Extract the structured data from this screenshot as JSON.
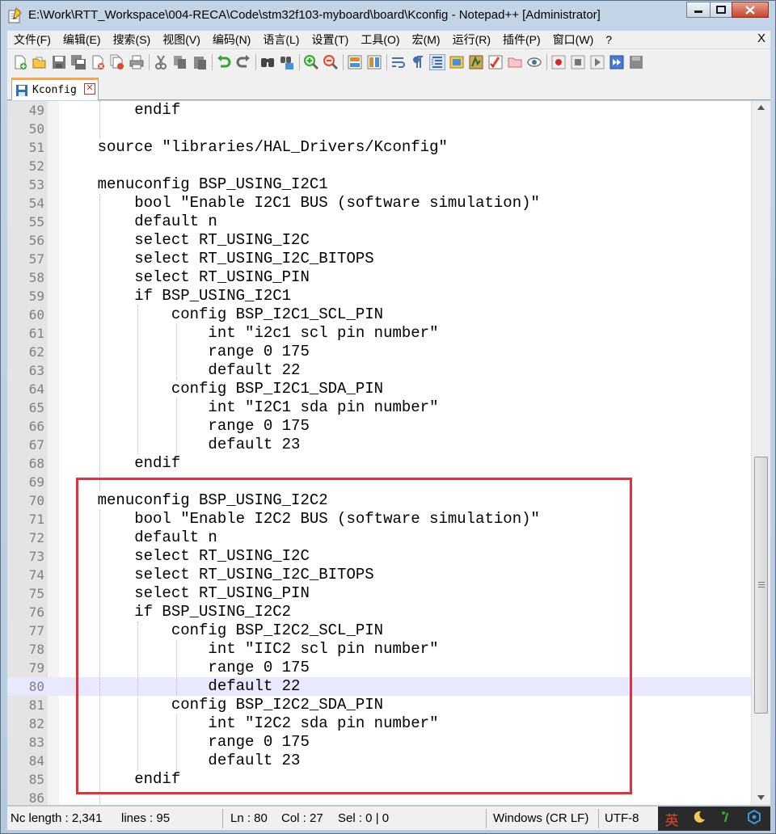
{
  "window": {
    "title": "E:\\Work\\RTT_Workspace\\004-RECA\\Code\\stm32f103-myboard\\board\\Kconfig - Notepad++ [Administrator]"
  },
  "menu": {
    "items": [
      "文件(F)",
      "编辑(E)",
      "搜索(S)",
      "视图(V)",
      "编码(N)",
      "语言(L)",
      "设置(T)",
      "工具(O)",
      "宏(M)",
      "运行(R)",
      "插件(P)",
      "窗口(W)",
      "?"
    ],
    "close_label": "X"
  },
  "toolbar": {
    "icons": [
      "new-file-icon",
      "open-file-icon",
      "save-icon",
      "save-all-icon",
      "close-icon",
      "close-all-icon",
      "print-icon",
      "cut-icon",
      "copy-icon",
      "paste-icon",
      "undo-icon",
      "redo-icon",
      "find-icon",
      "replace-icon",
      "zoom-in-icon",
      "zoom-out-icon",
      "sync-vertical-icon",
      "sync-horizontal-icon",
      "word-wrap-icon",
      "show-all-chars-icon",
      "indent-guide-icon",
      "doc-map-icon",
      "function-list-icon",
      "lang-icon",
      "folder-icon",
      "monitor-icon",
      "record-macro-icon",
      "stop-macro-icon",
      "play-macro-icon",
      "run-macro-multiple-icon",
      "save-macro-icon"
    ]
  },
  "tab": {
    "label": "Kconfig",
    "close_label": "✕"
  },
  "editor": {
    "lines": [
      {
        "n": "49",
        "text": "        endif",
        "current": false
      },
      {
        "n": "50",
        "text": "",
        "current": false
      },
      {
        "n": "51",
        "text": "    source \"libraries/HAL_Drivers/Kconfig\"",
        "current": false
      },
      {
        "n": "52",
        "text": "",
        "current": false
      },
      {
        "n": "53",
        "text": "    menuconfig BSP_USING_I2C1",
        "current": false
      },
      {
        "n": "54",
        "text": "        bool \"Enable I2C1 BUS (software simulation)\"",
        "current": false
      },
      {
        "n": "55",
        "text": "        default n",
        "current": false
      },
      {
        "n": "56",
        "text": "        select RT_USING_I2C",
        "current": false
      },
      {
        "n": "57",
        "text": "        select RT_USING_I2C_BITOPS",
        "current": false
      },
      {
        "n": "58",
        "text": "        select RT_USING_PIN",
        "current": false
      },
      {
        "n": "59",
        "text": "        if BSP_USING_I2C1",
        "current": false
      },
      {
        "n": "60",
        "text": "            config BSP_I2C1_SCL_PIN",
        "current": false
      },
      {
        "n": "61",
        "text": "                int \"i2c1 scl pin number\"",
        "current": false
      },
      {
        "n": "62",
        "text": "                range 0 175",
        "current": false
      },
      {
        "n": "63",
        "text": "                default 22",
        "current": false
      },
      {
        "n": "64",
        "text": "            config BSP_I2C1_SDA_PIN",
        "current": false
      },
      {
        "n": "65",
        "text": "                int \"I2C1 sda pin number\"",
        "current": false
      },
      {
        "n": "66",
        "text": "                range 0 175",
        "current": false
      },
      {
        "n": "67",
        "text": "                default 23",
        "current": false
      },
      {
        "n": "68",
        "text": "        endif",
        "current": false
      },
      {
        "n": "69",
        "text": "",
        "current": false
      },
      {
        "n": "70",
        "text": "    menuconfig BSP_USING_I2C2",
        "current": false
      },
      {
        "n": "71",
        "text": "        bool \"Enable I2C2 BUS (software simulation)\"",
        "current": false
      },
      {
        "n": "72",
        "text": "        default n",
        "current": false
      },
      {
        "n": "73",
        "text": "        select RT_USING_I2C",
        "current": false
      },
      {
        "n": "74",
        "text": "        select RT_USING_I2C_BITOPS",
        "current": false
      },
      {
        "n": "75",
        "text": "        select RT_USING_PIN",
        "current": false
      },
      {
        "n": "76",
        "text": "        if BSP_USING_I2C2",
        "current": false
      },
      {
        "n": "77",
        "text": "            config BSP_I2C2_SCL_PIN",
        "current": false
      },
      {
        "n": "78",
        "text": "                int \"IIC2 scl pin number\"",
        "current": false
      },
      {
        "n": "79",
        "text": "                range 0 175",
        "current": false
      },
      {
        "n": "80",
        "text": "                default 22",
        "current": true
      },
      {
        "n": "81",
        "text": "            config BSP_I2C2_SDA_PIN",
        "current": false
      },
      {
        "n": "82",
        "text": "                int \"I2C2 sda pin number\"",
        "current": false
      },
      {
        "n": "83",
        "text": "                range 0 175",
        "current": false
      },
      {
        "n": "84",
        "text": "                default 23",
        "current": false
      },
      {
        "n": "85",
        "text": "        endif",
        "current": false
      },
      {
        "n": "86",
        "text": "",
        "current": false
      }
    ]
  },
  "status": {
    "length": "Nc length : 2,341",
    "lines": "lines : 95",
    "ln": "Ln : 80",
    "col": "Col : 27",
    "sel": "Sel : 0 | 0",
    "eol": "Windows (CR LF)",
    "encoding": "UTF-8",
    "ime_lang": "英"
  },
  "colors": {
    "current_line": "#e8e8ff",
    "annotation_box": "#e5303b",
    "tab_accent": "#f7a44c"
  }
}
